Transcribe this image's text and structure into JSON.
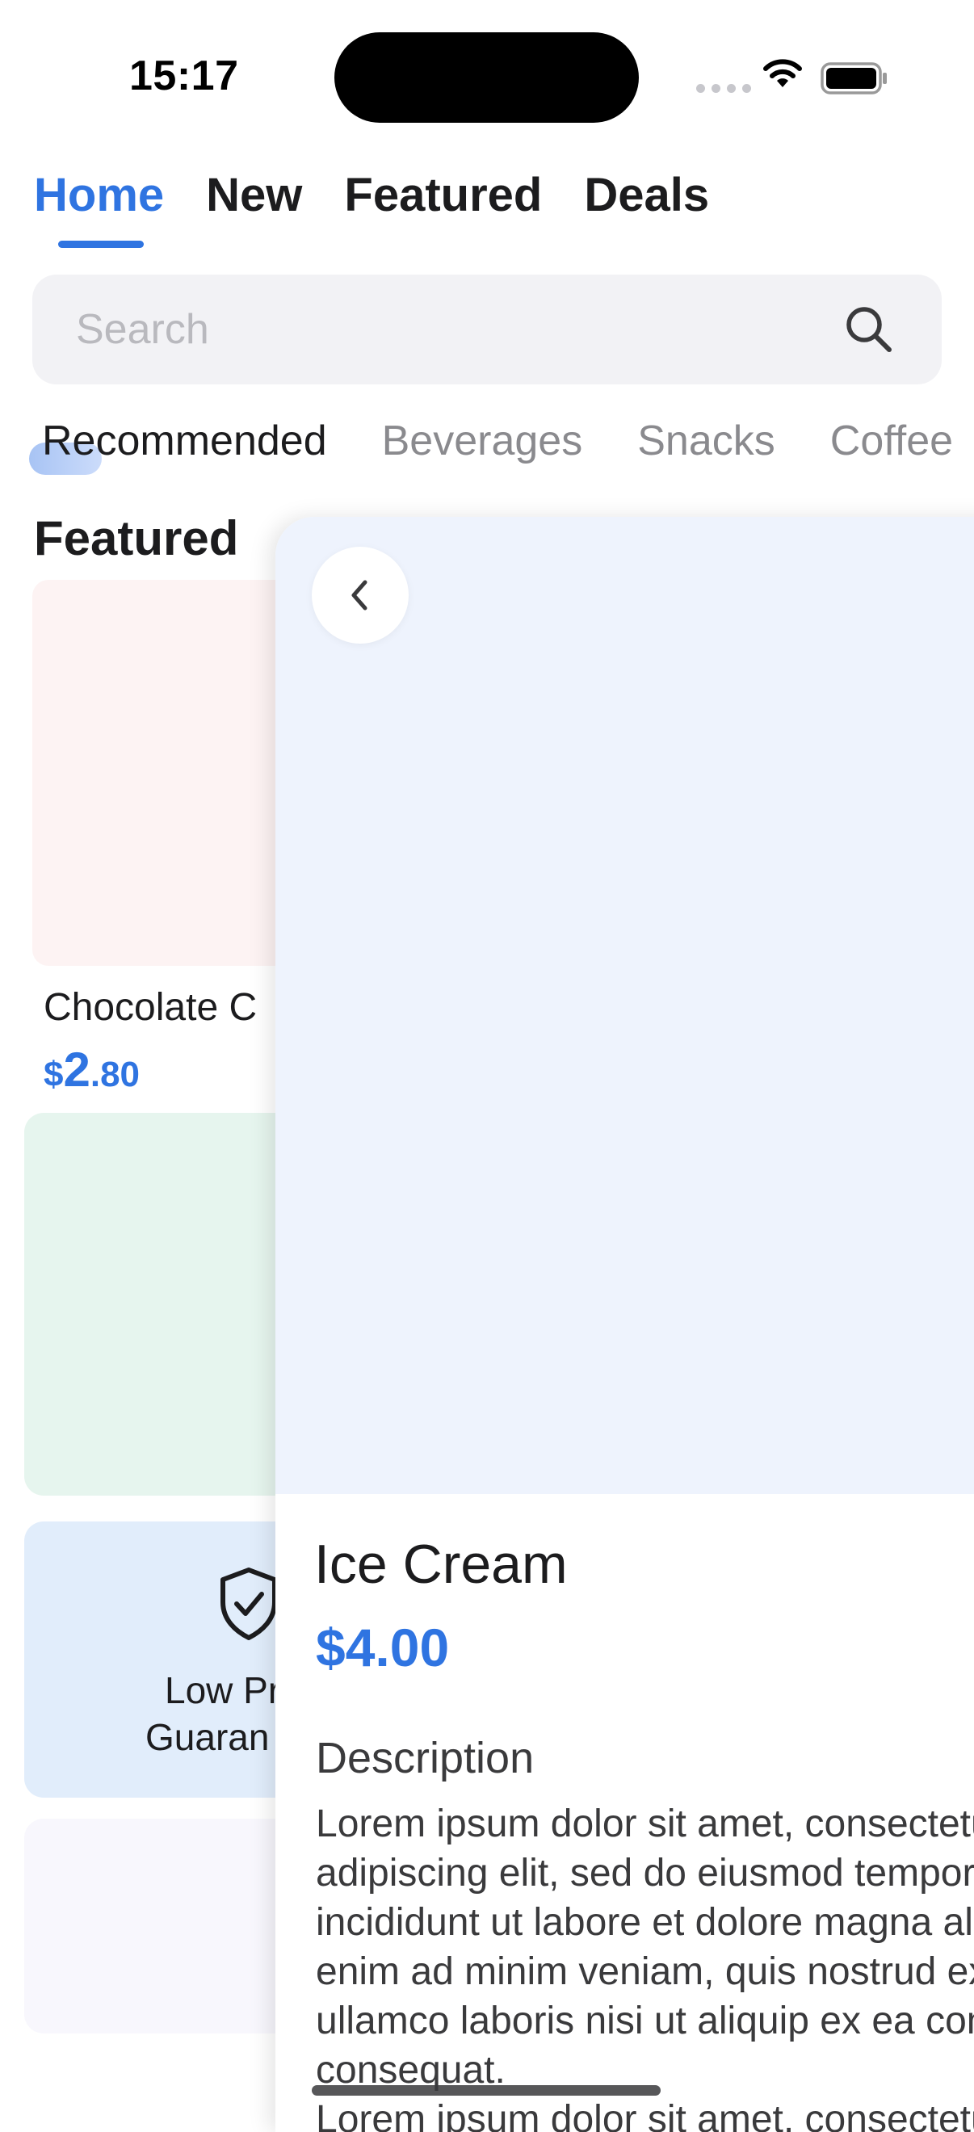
{
  "status_bar": {
    "time": "15:17"
  },
  "top_tabs": [
    {
      "label": "Home",
      "active": true
    },
    {
      "label": "New",
      "active": false
    },
    {
      "label": "Featured",
      "active": false
    },
    {
      "label": "Deals",
      "active": false
    }
  ],
  "search": {
    "placeholder": "Search"
  },
  "categories": [
    {
      "label": "Recommended",
      "active": true
    },
    {
      "label": "Beverages",
      "active": false
    },
    {
      "label": "Snacks",
      "active": false
    },
    {
      "label": "Coffee",
      "active": false
    }
  ],
  "featured": {
    "title": "Featured",
    "products": [
      {
        "name": "Chocolate C",
        "price_currency": "$",
        "price_whole": "2",
        "price_fraction": ".80"
      }
    ],
    "guarantee": {
      "line1": "Low Pr",
      "line2": "Guaran"
    }
  },
  "detail": {
    "title": "Ice Cream",
    "price": "$4.00",
    "description_heading": "Description",
    "description_lines": [
      "Lorem ipsum dolor sit amet, consectetur",
      "adipiscing elit, sed do eiusmod tempor",
      "incididunt ut labore et dolore magna aliqua. Ut",
      "enim ad minim veniam, quis nostrud exercitation",
      "ullamco laboris nisi ut aliquip ex ea commodo",
      "consequat.",
      "Lorem ipsum dolor sit amet, consectetur"
    ]
  },
  "colors": {
    "accent": "#2f74e1",
    "detail_image_bg": "#eef3fd",
    "card_pink": "#fdf3f3",
    "card_green": "#e6f5ee",
    "card_blue": "#e1edfb",
    "card_lavender": "#f8f7fd"
  },
  "icons": {
    "search": "search-icon",
    "back": "chevron-left-icon",
    "guarantee": "shield-check-icon",
    "wifi": "wifi-icon",
    "battery": "battery-icon"
  }
}
